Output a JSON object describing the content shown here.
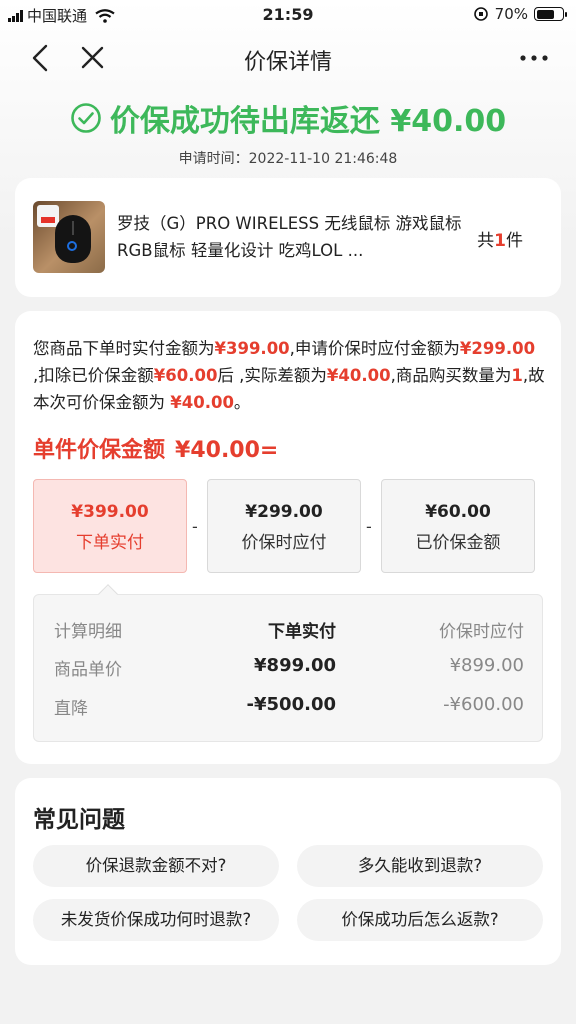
{
  "status_bar": {
    "carrier": "中国联通",
    "time": "21:59",
    "battery": "70%",
    "battery_level": 0.7
  },
  "nav": {
    "title": "价保详情"
  },
  "hero": {
    "headline": "价保成功待出库返还 ¥40.00",
    "apply_time": "申请时间：2022-11-10 21:46:48",
    "accent_color": "#3db85a"
  },
  "product": {
    "name": "罗技（G）PRO WIRELESS 无线鼠标 游戏鼠标 RGB鼠标 轻量化设计 吃鸡LOL ...",
    "qty_prefix": "共",
    "qty": "1",
    "qty_suffix": "件"
  },
  "explain": {
    "t1": "您商品下单时实付金额为",
    "paid": "¥399.00",
    "t2": ",申请价保时应付金额为",
    "due": "¥299.00",
    "t3": " ,扣除已价保金额",
    "protected": "¥60.00",
    "t4": "后 ,实际差额为",
    "diff": "¥40.00",
    "t5": ",商品购买数量为",
    "count": "1",
    "t6": ",故本次可价保金额为 ",
    "final": "¥40.00",
    "t7": "。"
  },
  "unit": {
    "label": "单件价保金额",
    "amount": "¥40.00="
  },
  "formula": {
    "boxes": [
      {
        "value": "¥399.00",
        "label": "下单实付"
      },
      {
        "value": "¥299.00",
        "label": "价保时应付"
      },
      {
        "value": "¥60.00",
        "label": "已价保金额"
      }
    ],
    "ops": [
      "-",
      "-"
    ]
  },
  "calc": {
    "headers": [
      "计算明细",
      "下单实付",
      "价保时应付"
    ],
    "rows": [
      [
        "商品单价",
        "¥899.00",
        "¥899.00"
      ],
      [
        "直降",
        "-¥500.00",
        "-¥600.00"
      ]
    ]
  },
  "faq": {
    "title": "常见问题",
    "items": [
      "价保退款金额不对?",
      "多久能收到退款?",
      "未发货价保成功何时退款?",
      "价保成功后怎么返款?"
    ]
  },
  "colors": {
    "red": "#e53e2e",
    "green": "#3db85a"
  }
}
